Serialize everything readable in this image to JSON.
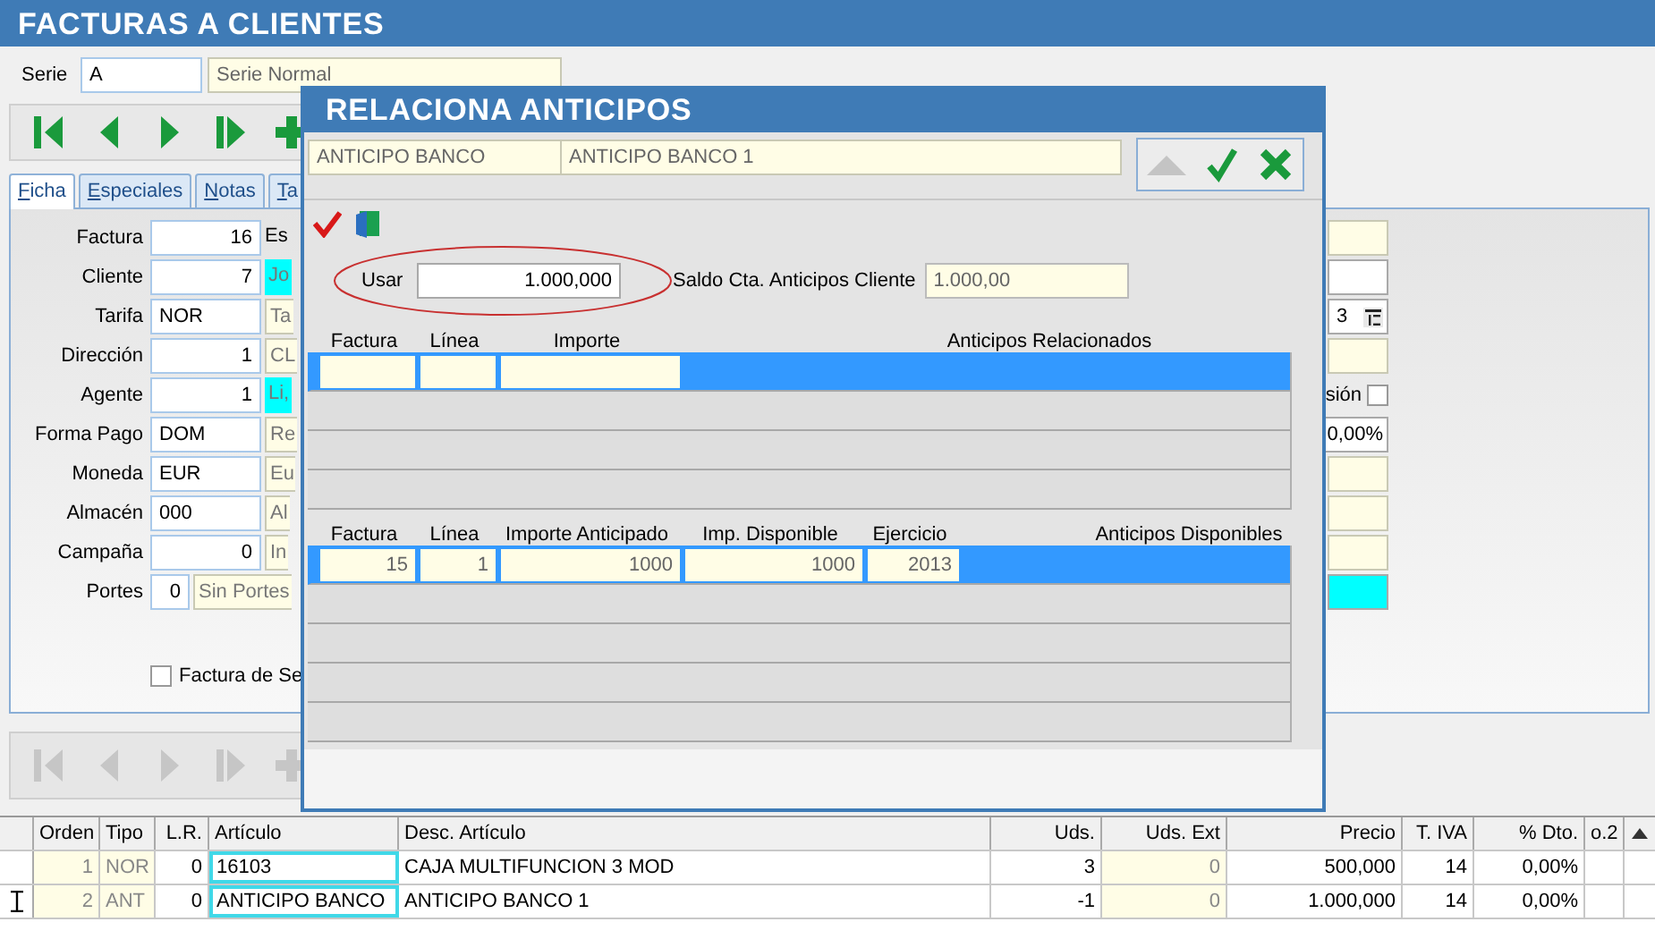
{
  "window": {
    "title": "FACTURAS A CLIENTES"
  },
  "serie": {
    "label": "Serie",
    "value": "A",
    "description": "Serie Normal"
  },
  "toolbar": {
    "disabled": false,
    "buttons": [
      {
        "kind": "first"
      },
      {
        "kind": "prev"
      },
      {
        "kind": "next"
      },
      {
        "kind": "last"
      },
      {
        "kind": "add"
      }
    ]
  },
  "tabs": [
    {
      "label": "Ficha",
      "selected": true
    },
    {
      "label": "Especiales",
      "selected": false
    },
    {
      "label": "Notas",
      "selected": false
    },
    {
      "label": "Ta",
      "selected": false
    }
  ],
  "form": {
    "fields": [
      {
        "label": "Factura",
        "kind": "number",
        "value": "16",
        "extra": {
          "kind": "label",
          "text": "Es"
        }
      },
      {
        "label": "Cliente",
        "kind": "number",
        "value": "7",
        "extra": {
          "kind": "highlight",
          "text": "Jo"
        }
      },
      {
        "label": "Tarifa",
        "kind": "text",
        "value": "NOR",
        "extra": {
          "kind": "readonly",
          "text": "Ta"
        }
      },
      {
        "label": "Dirección",
        "kind": "number",
        "value": "1",
        "extra": {
          "kind": "readonly",
          "text": "CL"
        }
      },
      {
        "label": "Agente",
        "kind": "number",
        "value": "1",
        "extra": {
          "kind": "highlight",
          "text": "Li,"
        }
      },
      {
        "label": "Forma Pago",
        "kind": "text",
        "value": "DOM",
        "extra": {
          "kind": "readonly",
          "text": "Re"
        }
      },
      {
        "label": "Moneda",
        "kind": "text",
        "value": "EUR",
        "extra": {
          "kind": "readonly",
          "text": "Eu"
        }
      },
      {
        "label": "Almacén",
        "kind": "text",
        "value": "000",
        "extra": {
          "kind": "readonly",
          "text": "Al"
        }
      },
      {
        "label": "Campaña",
        "kind": "number",
        "value": "0",
        "extra": {
          "kind": "readonly",
          "text": "In"
        }
      },
      {
        "label": "Portes",
        "kind": "short",
        "value": "0",
        "extra": {
          "kind": "readonly",
          "text": "Sin Portes"
        }
      }
    ],
    "checkbox": {
      "label": "Factura de Se",
      "checked": false
    },
    "right_fields": [
      {
        "kind": "readonly"
      },
      {
        "kind": "input"
      },
      {
        "kind": "date",
        "value": "3"
      },
      {
        "kind": "readonly"
      },
      {
        "kind": "checkbox",
        "label": "sión",
        "checked": false
      },
      {
        "kind": "value",
        "value": "0,00%"
      },
      {
        "kind": "readonly"
      },
      {
        "kind": "readonly"
      },
      {
        "kind": "readonly"
      },
      {
        "kind": "highlight"
      }
    ]
  },
  "lines_toolbar": {
    "disabled": true,
    "buttons": [
      {
        "kind": "first"
      },
      {
        "kind": "prev"
      },
      {
        "kind": "next"
      },
      {
        "kind": "last"
      },
      {
        "kind": "add"
      }
    ]
  },
  "lines": {
    "columns": [
      {
        "label": "Orden",
        "kind": "readonly"
      },
      {
        "label": "Tipo",
        "kind": "readonly_text"
      },
      {
        "label": "L.R.",
        "kind": "number"
      },
      {
        "label": "Artículo",
        "kind": "code"
      },
      {
        "label": "Desc. Artículo",
        "kind": "text"
      },
      {
        "label": "Uds.",
        "kind": "number"
      },
      {
        "label": "Uds. Ext",
        "kind": "readonly"
      },
      {
        "label": "Precio",
        "kind": "number"
      },
      {
        "label": "T. IVA",
        "kind": "number"
      },
      {
        "label": "% Dto.",
        "kind": "number"
      },
      {
        "label": "o.2",
        "kind": "text"
      }
    ],
    "rows": [
      {
        "editing": false,
        "cells": [
          "1",
          "NOR",
          "0",
          "16103",
          "CAJA MULTIFUNCION 3 MOD",
          "3",
          "0",
          "500,000",
          "14",
          "0,00%"
        ]
      },
      {
        "editing": true,
        "cells": [
          "2",
          "ANT",
          "0",
          "ANTICIPO BANCO",
          "ANTICIPO BANCO 1",
          "-1",
          "0",
          "1.000,000",
          "14",
          "0,00%"
        ]
      }
    ]
  },
  "dialog": {
    "title": "RELACIONA ANTICIPOS",
    "header_fields": [
      "ANTICIPO BANCO",
      "ANTICIPO BANCO 1"
    ],
    "buttons": [
      {
        "kind": "up",
        "disabled": true
      },
      {
        "kind": "accept",
        "disabled": false
      },
      {
        "kind": "cancel",
        "disabled": false
      }
    ],
    "usar": {
      "label": "Usar",
      "value": "1.000,000"
    },
    "saldo": {
      "label": "Saldo Cta. Anticipos Cliente",
      "value": "1.000,00"
    },
    "related": {
      "title": "Anticipos Relacionados",
      "columns": [
        "Factura",
        "Línea",
        "Importe"
      ],
      "rows": [
        {
          "selected": true
        },
        {
          "selected": false
        },
        {
          "selected": false
        },
        {
          "selected": false
        }
      ]
    },
    "available": {
      "title": "Anticipos Disponibles",
      "columns": [
        "Factura",
        "Línea",
        "Importe Anticipado",
        "Imp. Disponible",
        "Ejercicio"
      ],
      "rows": [
        {
          "selected": true,
          "cells": [
            "15",
            "1",
            "1000",
            "1000",
            "2013"
          ]
        },
        {
          "selected": false
        },
        {
          "selected": false
        },
        {
          "selected": false
        },
        {
          "selected": false
        }
      ]
    }
  }
}
